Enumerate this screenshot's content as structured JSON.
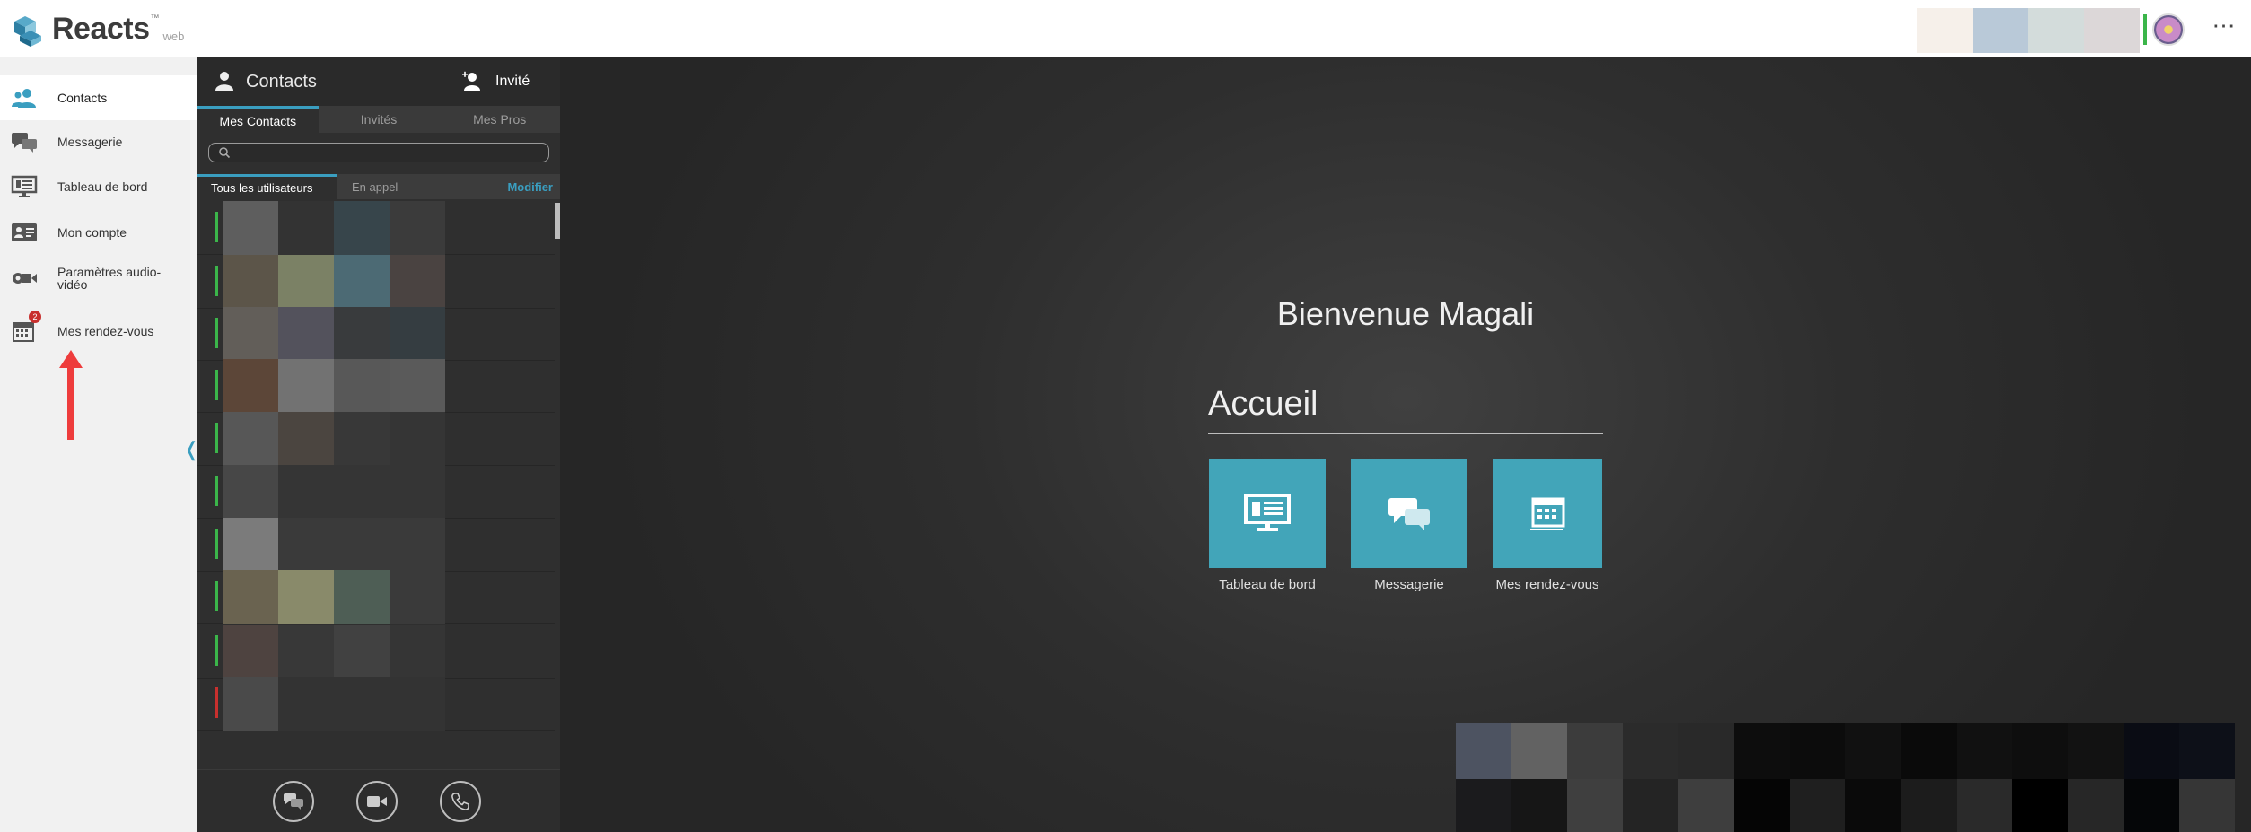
{
  "app": {
    "name": "Reacts",
    "trademark": "™",
    "edition": "web",
    "accent_color": "#3a9ec0",
    "tile_color": "#42a5b9"
  },
  "header": {
    "more_icon": "more-horizontal-icon",
    "more_label": "⋯",
    "status_color": "#3bb54a"
  },
  "sidebar": {
    "items": [
      {
        "label": "Contacts",
        "icon": "contacts-icon",
        "active": true
      },
      {
        "label": "Messagerie",
        "icon": "chat-icon"
      },
      {
        "label": "Tableau de bord",
        "icon": "dashboard-icon"
      },
      {
        "label": "Mon compte",
        "icon": "account-card-icon"
      },
      {
        "label": "Paramètres audio-vidéo",
        "icon": "av-settings-icon"
      },
      {
        "label": "Mes rendez-vous",
        "icon": "calendar-icon",
        "badge": "2"
      }
    ],
    "collapse_glyph": "❬"
  },
  "contacts": {
    "title": "Contacts",
    "invite_label": "Invité",
    "tabs": [
      "Mes Contacts",
      "Invités",
      "Mes Pros"
    ],
    "active_tab": "Mes Contacts",
    "search": {
      "value": "",
      "placeholder": ""
    },
    "subtabs": [
      "Tous les utilisateurs",
      "En appel"
    ],
    "active_subtab": "Tous les utilisateurs",
    "modify_label": "Modifier",
    "rows": [
      {
        "status": "#3bb54a",
        "tiles": [
          "#5e5e5e",
          "#333333",
          "#37454b",
          "#3b3b3b"
        ]
      },
      {
        "status": "#3bb54a",
        "tiles": [
          "#5c5549",
          "#7b8165",
          "#4c6a74",
          "#4a4341"
        ]
      },
      {
        "status": "#3bb54a",
        "tiles": [
          "#625e59",
          "#53525c",
          "#393b3d",
          "#353d41"
        ]
      },
      {
        "status": "#3bb54a",
        "tiles": [
          "#5c4638",
          "#727272",
          "#585858",
          "#5a5a5a"
        ]
      },
      {
        "status": "#3bb54a",
        "tiles": [
          "#575757",
          "#4b4540",
          "#383838",
          "#353535"
        ]
      },
      {
        "status": "#3bb54a",
        "tiles": [
          "#474747",
          "#353535",
          "#353535",
          "#353535"
        ]
      },
      {
        "status": "#3bb54a",
        "tiles": [
          "#7b7b7b",
          "#3a3a3a",
          "#3a3a3a",
          "#3a3a3a"
        ]
      },
      {
        "status": "#3bb54a",
        "tiles": [
          "#6a6350",
          "#898a6a",
          "#4e5e55",
          "#3a3a3a"
        ]
      },
      {
        "status": "#3bb54a",
        "tiles": [
          "#4e4340",
          "#383838",
          "#414141",
          "#353535"
        ]
      },
      {
        "status": "#c8302e",
        "tiles": [
          "#4a4a4a",
          "#333333",
          "#333333",
          "#333333"
        ]
      }
    ],
    "footer_actions": [
      {
        "label": "chat",
        "icon": "chat-bubble-icon"
      },
      {
        "label": "video",
        "icon": "video-camera-icon"
      },
      {
        "label": "call",
        "icon": "phone-icon"
      }
    ]
  },
  "main": {
    "welcome": "Bienvenue Magali",
    "section_title": "Accueil",
    "tiles": [
      {
        "label": "Tableau de bord",
        "icon": "dashboard-icon"
      },
      {
        "label": "Messagerie",
        "icon": "chat-icon"
      },
      {
        "label": "Mes rendez-vous",
        "icon": "calendar-icon"
      }
    ]
  },
  "top_tiles": [
    "#f6f0ea",
    "#b9c9d8",
    "#d3dcdb",
    "#dcd7d8"
  ],
  "bottom_blocks": [
    "#4d5361",
    "#626262",
    "#3c3c3c",
    "#2b2b2b",
    "#292929",
    "#0d0d0d",
    "#0c0c0c",
    "#111111",
    "#0a0a0a",
    "#111111",
    "#0e0e0e",
    "#121212",
    "#0a0c14",
    "#0d1018",
    "#1b1b1d",
    "#161616",
    "#3f3f3f",
    "#242424",
    "#3e3e3e",
    "#050505",
    "#1f1f1f",
    "#0a0a0a",
    "#1c1c1c",
    "#2a2a2a",
    "#000000",
    "#272727",
    "#050608",
    "#363636"
  ]
}
